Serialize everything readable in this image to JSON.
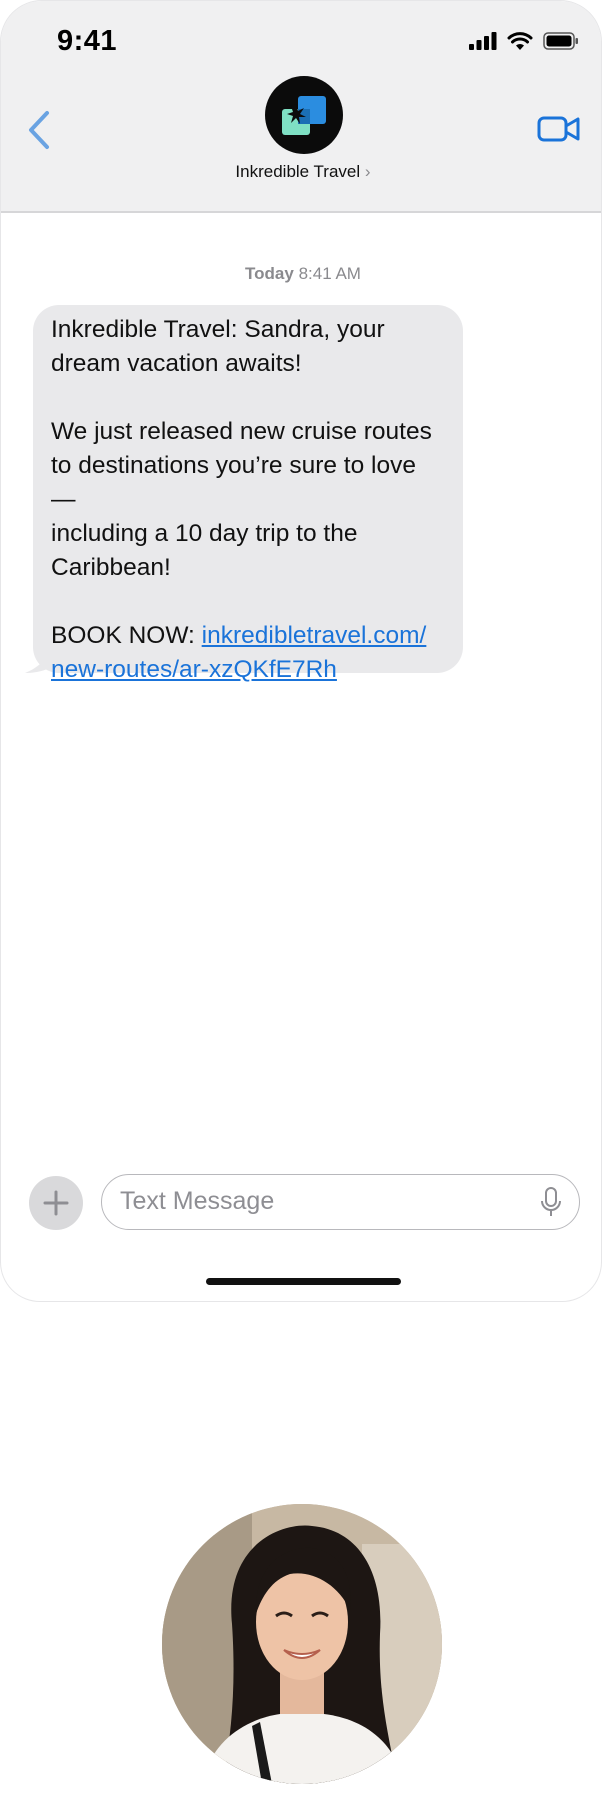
{
  "status_bar": {
    "time": "9:41"
  },
  "header": {
    "contact_name": "Inkredible Travel",
    "contact_chevron": "›"
  },
  "thread": {
    "timestamp_day": "Today",
    "timestamp_time": "8:41 AM",
    "message": {
      "line1": "Inkredible Travel: Sandra, your",
      "line2": "dream vacation awaits!",
      "line3": "We just released new cruise routes",
      "line4": "to destinations you’re sure to love —",
      "line5": "including a 10 day trip to the",
      "line6": "Caribbean!",
      "cta_label": "BOOK NOW: ",
      "link_part1": "inkredibletravel.com/",
      "link_part2": "new-routes/ar-xzQKfE7Rh"
    }
  },
  "composer": {
    "placeholder": "Text Message"
  },
  "colors": {
    "accent": "#1a73d9",
    "bubble_bg": "#e9e9eb",
    "logo_blue": "#2b8de0",
    "logo_mint": "#7fe0c4"
  },
  "icons": {
    "back": "chevron-left-icon",
    "video": "video-camera-icon",
    "plus": "plus-icon",
    "mic": "microphone-icon",
    "signal": "cellular-signal-icon",
    "wifi": "wifi-icon",
    "battery": "battery-icon"
  }
}
